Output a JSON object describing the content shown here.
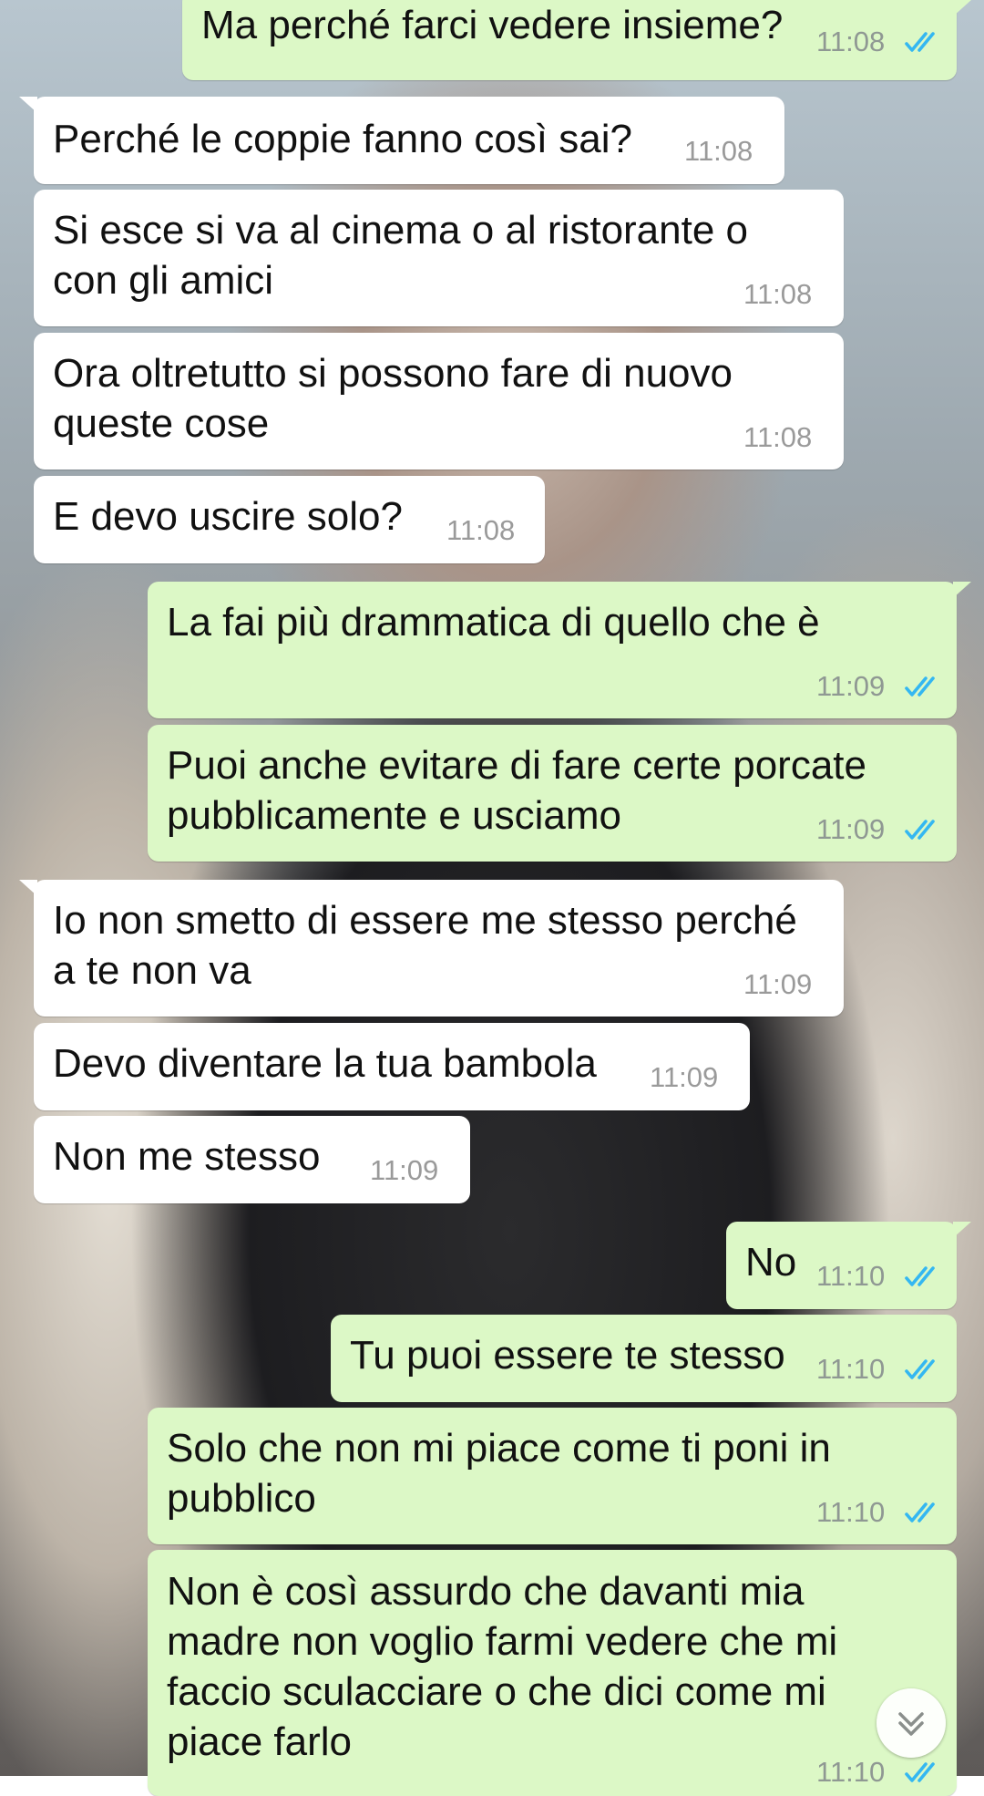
{
  "chat": {
    "messages": [
      {
        "dir": "out",
        "text": "Ma perché farci vedere insieme?",
        "time": "11:08",
        "status": "read"
      },
      {
        "dir": "in",
        "text": "Perché le coppie fanno così sai?",
        "time": "11:08"
      },
      {
        "dir": "in",
        "text": "Si esce si va al cinema o al ristorante o\ncon gli amici",
        "time": "11:08"
      },
      {
        "dir": "in",
        "text": "Ora oltretutto si possono fare di nuovo\nqueste cose",
        "time": "11:08"
      },
      {
        "dir": "in",
        "text": "E devo uscire solo?",
        "time": "11:08"
      },
      {
        "dir": "out",
        "text": "La fai più drammatica di quello che è",
        "time": "11:09",
        "status": "read"
      },
      {
        "dir": "out",
        "text": "Puoi anche evitare di fare certe porcate\npubblicamente e usciamo",
        "time": "11:09",
        "status": "read"
      },
      {
        "dir": "in",
        "text": "Io non smetto di essere me stesso perché\na te non va",
        "time": "11:09"
      },
      {
        "dir": "in",
        "text": "Devo diventare la tua bambola",
        "time": "11:09"
      },
      {
        "dir": "in",
        "text": "Non me stesso",
        "time": "11:09"
      },
      {
        "dir": "out",
        "text": "No",
        "time": "11:10",
        "status": "read"
      },
      {
        "dir": "out",
        "text": "Tu puoi essere te stesso",
        "time": "11:10",
        "status": "read"
      },
      {
        "dir": "out",
        "text": "Solo che non mi piace come ti poni in\npubblico",
        "time": "11:10",
        "status": "read"
      },
      {
        "dir": "out",
        "text": "Non è così assurdo che davanti mia\nmadre non voglio farmi vedere che mi\nfaccio sculacciare o che dici come mi\npiace farlo",
        "time": "11:10",
        "status": "read"
      }
    ]
  },
  "icons": {
    "read_receipt": "double-check-icon",
    "scroll_down": "double-chevron-down-icon"
  },
  "colors": {
    "incoming_bubble": "#ffffff",
    "outgoing_bubble": "#dcf8c6",
    "read_tick": "#34b7f1",
    "timestamp": "#8f9893"
  }
}
